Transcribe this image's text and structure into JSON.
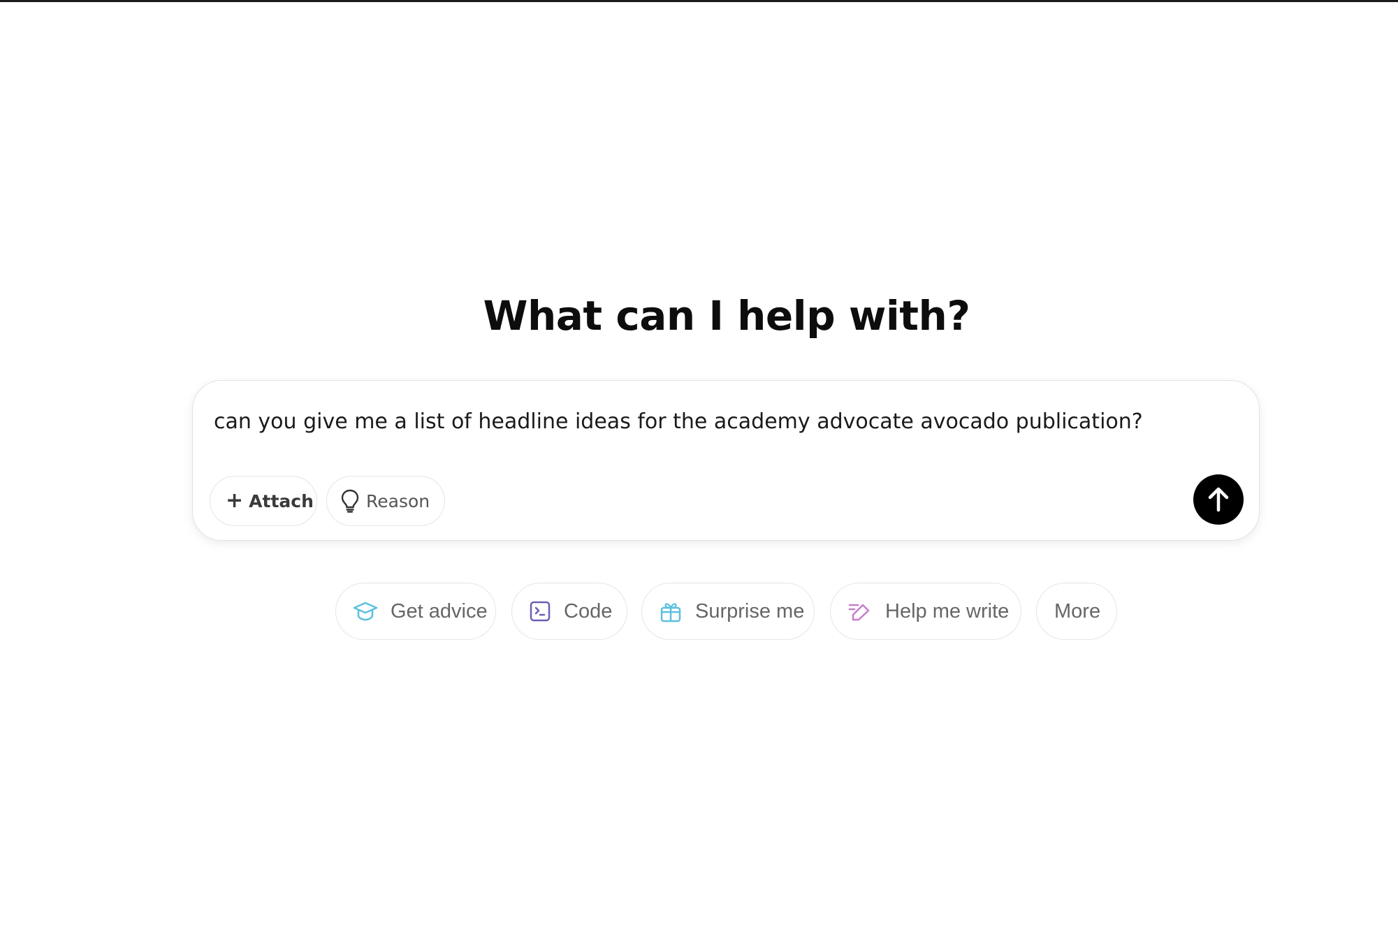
{
  "main": {
    "heading": "What can I help with?"
  },
  "composer": {
    "input_value": "can you give me a list of headline ideas for the academy advocate avocado publication?",
    "attach_label": "Attach",
    "reason_label": "Reason",
    "send_icon": "arrow-up-icon"
  },
  "suggestions": [
    {
      "label": "Get advice",
      "icon": "graduation-cap-icon",
      "color": "#5bc0de"
    },
    {
      "label": "Code",
      "icon": "terminal-icon",
      "color": "#6b5fb5"
    },
    {
      "label": "Surprise me",
      "icon": "gift-icon",
      "color": "#5bc0de"
    },
    {
      "label": "Help me write",
      "icon": "pen-icon",
      "color": "#c77dcb"
    },
    {
      "label": "More",
      "icon": "",
      "color": "#666666"
    }
  ]
}
